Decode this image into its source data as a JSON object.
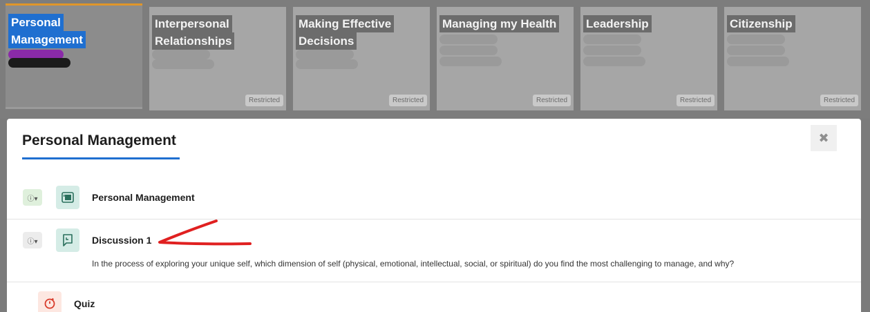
{
  "tiles": [
    {
      "title_line1": "Personal",
      "title_line2": "Management",
      "restricted": ""
    },
    {
      "title_line1": "Interpersonal",
      "title_line2": "Relationships",
      "restricted": "Restricted"
    },
    {
      "title_line1": "Making Effective",
      "title_line2": "Decisions",
      "restricted": "Restricted"
    },
    {
      "title_line1": "Managing my Health",
      "title_line2": "",
      "restricted": "Restricted"
    },
    {
      "title_line1": "Leadership",
      "title_line2": "",
      "restricted": "Restricted"
    },
    {
      "title_line1": "Citizenship",
      "title_line2": "",
      "restricted": "Restricted"
    }
  ],
  "modal": {
    "title": "Personal Management",
    "close_label": "✖",
    "items": [
      {
        "type": "page",
        "label": "Personal Management",
        "status_icon": "ⓘ▾",
        "description": ""
      },
      {
        "type": "discussion",
        "label": "Discussion 1",
        "status_icon": "ⓘ▾",
        "description": "In the process of exploring your unique self, which dimension of self (physical, emotional, intellectual, social, or spiritual) do you find the most challenging to manage, and why?"
      },
      {
        "type": "quiz",
        "label": "Quiz",
        "status_icon": "",
        "description": ""
      }
    ]
  },
  "colors": {
    "accent": "#1f6fd0",
    "annotation": "#e02020",
    "active_tile_top": "#e0962a"
  }
}
